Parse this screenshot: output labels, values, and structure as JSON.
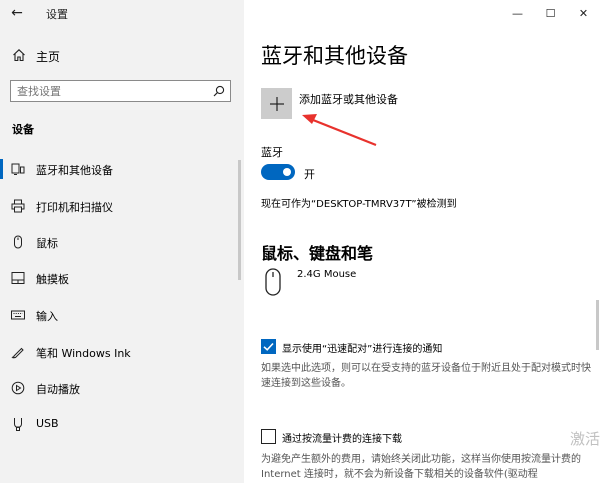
{
  "window": {
    "title": "设置",
    "back_glyph": "←",
    "minimize_glyph": "—",
    "maximize_glyph": "☐",
    "close_glyph": "✕"
  },
  "sidebar": {
    "home_label": "主页",
    "search_placeholder": "查找设置",
    "section_label": "设备",
    "items": [
      {
        "label": "蓝牙和其他设备",
        "icon": "bluetooth-devices-icon",
        "selected": true
      },
      {
        "label": "打印机和扫描仪",
        "icon": "printer-icon",
        "selected": false
      },
      {
        "label": "鼠标",
        "icon": "mouse-icon",
        "selected": false
      },
      {
        "label": "触摸板",
        "icon": "touchpad-icon",
        "selected": false
      },
      {
        "label": "输入",
        "icon": "keyboard-icon",
        "selected": false
      },
      {
        "label": "笔和 Windows Ink",
        "icon": "pen-icon",
        "selected": false
      },
      {
        "label": "自动播放",
        "icon": "autoplay-icon",
        "selected": false
      },
      {
        "label": "USB",
        "icon": "usb-icon",
        "selected": false
      }
    ]
  },
  "main": {
    "page_title": "蓝牙和其他设备",
    "add_device_label": "添加蓝牙或其他设备",
    "add_device_glyph": "+",
    "bluetooth_label": "蓝牙",
    "bluetooth_state": "开",
    "discoverable_text": "现在可作为“DESKTOP-TMRV37T”被检测到",
    "mouse_section_title": "鼠标、键盘和笔",
    "devices": [
      {
        "name": "2.4G Mouse",
        "icon": "mouse-icon"
      }
    ],
    "swift_pair": {
      "label": "显示使用“迅速配对”进行连接的通知",
      "checked": true,
      "description": "如果选中此选项，则可以在受支持的蓝牙设备位于附近且处于配对模式时快速连接到这些设备。"
    },
    "metered": {
      "label": "通过按流量计费的连接下载",
      "checked": false,
      "description": "为避免产生额外的费用，请始终关闭此功能，这样当你使用按流量计费的 Internet 连接时，就不会为新设备下载相关的设备软件(驱动程"
    },
    "watermark": "激活"
  },
  "colors": {
    "accent": "#0067c0",
    "sidebar_bg": "#f2f2f2",
    "annotation_arrow": "#e8322d"
  }
}
